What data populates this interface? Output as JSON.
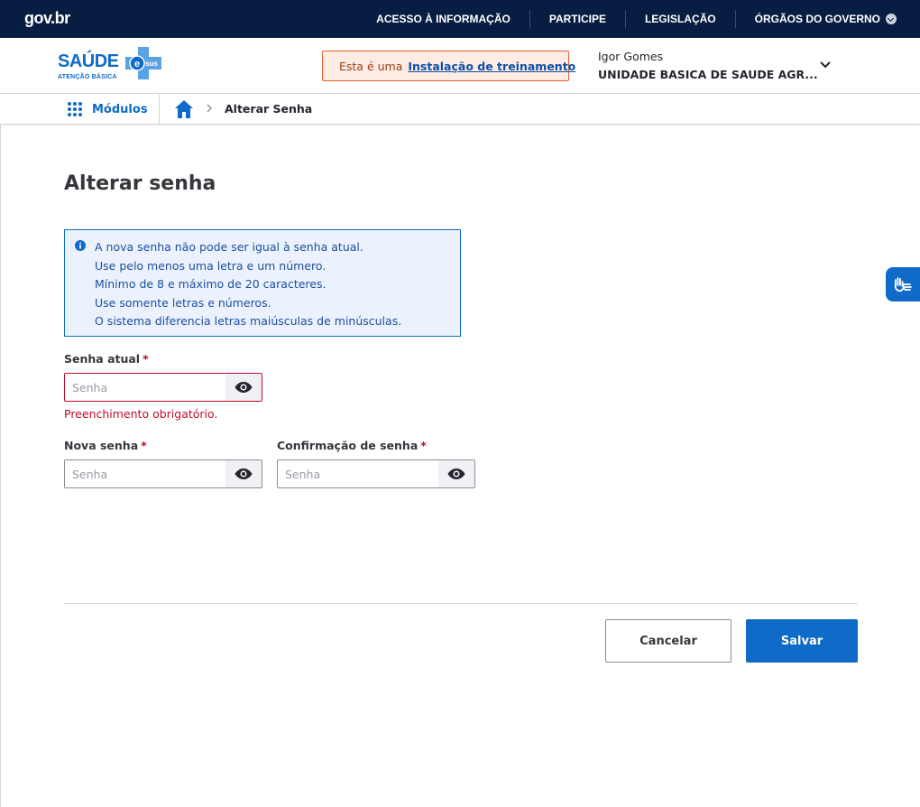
{
  "govbar": {
    "logo": "gov.br",
    "links": [
      "ACESSO À INFORMAÇÃO",
      "PARTICIPE",
      "LEGISLAÇÃO",
      "ÓRGÃOS DO GOVERNO"
    ]
  },
  "header": {
    "logo_main": "SAÚDE",
    "logo_sub": "ATENÇÃO BÁSICA",
    "logo_badge": "sus",
    "training_prefix": "Esta é uma",
    "training_link": "Instalação de treinamento",
    "user_name": "Igor Gomes",
    "user_unit": "UNIDADE BASICA DE SAUDE AGR..."
  },
  "nav": {
    "modules_label": "Módulos",
    "breadcrumb_current": "Alterar Senha"
  },
  "main": {
    "title": "Alterar senha",
    "info_lines": [
      "A nova senha não pode ser igual à senha atual.",
      "Use pelo menos uma letra e um número.",
      "Mínimo de 8 e máximo de 20 caracteres.",
      "Use somente letras e números.",
      "O sistema diferencia letras maiúsculas de minúsculas."
    ],
    "current_password": {
      "label": "Senha atual",
      "placeholder": "Senha",
      "error": "Preenchimento obrigatório."
    },
    "new_password": {
      "label": "Nova senha",
      "placeholder": "Senha"
    },
    "confirm_password": {
      "label": "Confirmação de senha",
      "placeholder": "Senha"
    },
    "required_mark": "*",
    "cancel_label": "Cancelar",
    "save_label": "Salvar"
  },
  "colors": {
    "govbar_bg": "#071d41",
    "primary": "#0f6bc7",
    "error": "#c00b2b",
    "warning_border": "#e0622f",
    "info_bg": "#ebf2fd"
  }
}
